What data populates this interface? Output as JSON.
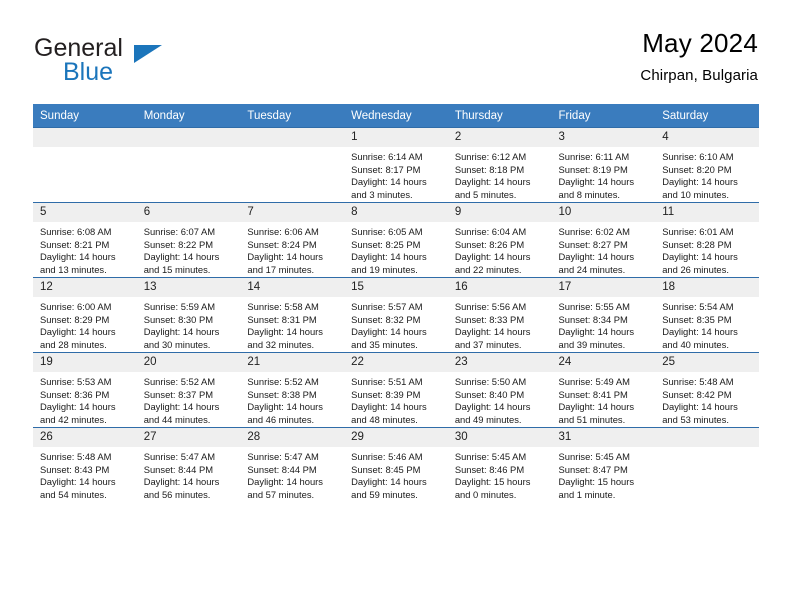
{
  "brand": {
    "name_part1": "General",
    "name_part2": "Blue",
    "triangle_icon": "triangle-icon",
    "accent_color": "#1b75bb"
  },
  "header": {
    "title": "May 2024",
    "subtitle": "Chirpan, Bulgaria"
  },
  "theme": {
    "header_row_bg": "#3a7cbe",
    "row_divider": "#2f6ca8",
    "daynum_bg": "#efefef"
  },
  "calendar": {
    "weekday_headers": [
      "Sunday",
      "Monday",
      "Tuesday",
      "Wednesday",
      "Thursday",
      "Friday",
      "Saturday"
    ],
    "weeks": [
      [
        {
          "day": "",
          "empty": true,
          "sunrise": "",
          "sunset": "",
          "daylight1": "",
          "daylight2": ""
        },
        {
          "day": "",
          "empty": true,
          "sunrise": "",
          "sunset": "",
          "daylight1": "",
          "daylight2": ""
        },
        {
          "day": "",
          "empty": true,
          "sunrise": "",
          "sunset": "",
          "daylight1": "",
          "daylight2": ""
        },
        {
          "day": "1",
          "empty": false,
          "sunrise": "Sunrise: 6:14 AM",
          "sunset": "Sunset: 8:17 PM",
          "daylight1": "Daylight: 14 hours",
          "daylight2": "and 3 minutes."
        },
        {
          "day": "2",
          "empty": false,
          "sunrise": "Sunrise: 6:12 AM",
          "sunset": "Sunset: 8:18 PM",
          "daylight1": "Daylight: 14 hours",
          "daylight2": "and 5 minutes."
        },
        {
          "day": "3",
          "empty": false,
          "sunrise": "Sunrise: 6:11 AM",
          "sunset": "Sunset: 8:19 PM",
          "daylight1": "Daylight: 14 hours",
          "daylight2": "and 8 minutes."
        },
        {
          "day": "4",
          "empty": false,
          "sunrise": "Sunrise: 6:10 AM",
          "sunset": "Sunset: 8:20 PM",
          "daylight1": "Daylight: 14 hours",
          "daylight2": "and 10 minutes."
        }
      ],
      [
        {
          "day": "5",
          "empty": false,
          "sunrise": "Sunrise: 6:08 AM",
          "sunset": "Sunset: 8:21 PM",
          "daylight1": "Daylight: 14 hours",
          "daylight2": "and 13 minutes."
        },
        {
          "day": "6",
          "empty": false,
          "sunrise": "Sunrise: 6:07 AM",
          "sunset": "Sunset: 8:22 PM",
          "daylight1": "Daylight: 14 hours",
          "daylight2": "and 15 minutes."
        },
        {
          "day": "7",
          "empty": false,
          "sunrise": "Sunrise: 6:06 AM",
          "sunset": "Sunset: 8:24 PM",
          "daylight1": "Daylight: 14 hours",
          "daylight2": "and 17 minutes."
        },
        {
          "day": "8",
          "empty": false,
          "sunrise": "Sunrise: 6:05 AM",
          "sunset": "Sunset: 8:25 PM",
          "daylight1": "Daylight: 14 hours",
          "daylight2": "and 19 minutes."
        },
        {
          "day": "9",
          "empty": false,
          "sunrise": "Sunrise: 6:04 AM",
          "sunset": "Sunset: 8:26 PM",
          "daylight1": "Daylight: 14 hours",
          "daylight2": "and 22 minutes."
        },
        {
          "day": "10",
          "empty": false,
          "sunrise": "Sunrise: 6:02 AM",
          "sunset": "Sunset: 8:27 PM",
          "daylight1": "Daylight: 14 hours",
          "daylight2": "and 24 minutes."
        },
        {
          "day": "11",
          "empty": false,
          "sunrise": "Sunrise: 6:01 AM",
          "sunset": "Sunset: 8:28 PM",
          "daylight1": "Daylight: 14 hours",
          "daylight2": "and 26 minutes."
        }
      ],
      [
        {
          "day": "12",
          "empty": false,
          "sunrise": "Sunrise: 6:00 AM",
          "sunset": "Sunset: 8:29 PM",
          "daylight1": "Daylight: 14 hours",
          "daylight2": "and 28 minutes."
        },
        {
          "day": "13",
          "empty": false,
          "sunrise": "Sunrise: 5:59 AM",
          "sunset": "Sunset: 8:30 PM",
          "daylight1": "Daylight: 14 hours",
          "daylight2": "and 30 minutes."
        },
        {
          "day": "14",
          "empty": false,
          "sunrise": "Sunrise: 5:58 AM",
          "sunset": "Sunset: 8:31 PM",
          "daylight1": "Daylight: 14 hours",
          "daylight2": "and 32 minutes."
        },
        {
          "day": "15",
          "empty": false,
          "sunrise": "Sunrise: 5:57 AM",
          "sunset": "Sunset: 8:32 PM",
          "daylight1": "Daylight: 14 hours",
          "daylight2": "and 35 minutes."
        },
        {
          "day": "16",
          "empty": false,
          "sunrise": "Sunrise: 5:56 AM",
          "sunset": "Sunset: 8:33 PM",
          "daylight1": "Daylight: 14 hours",
          "daylight2": "and 37 minutes."
        },
        {
          "day": "17",
          "empty": false,
          "sunrise": "Sunrise: 5:55 AM",
          "sunset": "Sunset: 8:34 PM",
          "daylight1": "Daylight: 14 hours",
          "daylight2": "and 39 minutes."
        },
        {
          "day": "18",
          "empty": false,
          "sunrise": "Sunrise: 5:54 AM",
          "sunset": "Sunset: 8:35 PM",
          "daylight1": "Daylight: 14 hours",
          "daylight2": "and 40 minutes."
        }
      ],
      [
        {
          "day": "19",
          "empty": false,
          "sunrise": "Sunrise: 5:53 AM",
          "sunset": "Sunset: 8:36 PM",
          "daylight1": "Daylight: 14 hours",
          "daylight2": "and 42 minutes."
        },
        {
          "day": "20",
          "empty": false,
          "sunrise": "Sunrise: 5:52 AM",
          "sunset": "Sunset: 8:37 PM",
          "daylight1": "Daylight: 14 hours",
          "daylight2": "and 44 minutes."
        },
        {
          "day": "21",
          "empty": false,
          "sunrise": "Sunrise: 5:52 AM",
          "sunset": "Sunset: 8:38 PM",
          "daylight1": "Daylight: 14 hours",
          "daylight2": "and 46 minutes."
        },
        {
          "day": "22",
          "empty": false,
          "sunrise": "Sunrise: 5:51 AM",
          "sunset": "Sunset: 8:39 PM",
          "daylight1": "Daylight: 14 hours",
          "daylight2": "and 48 minutes."
        },
        {
          "day": "23",
          "empty": false,
          "sunrise": "Sunrise: 5:50 AM",
          "sunset": "Sunset: 8:40 PM",
          "daylight1": "Daylight: 14 hours",
          "daylight2": "and 49 minutes."
        },
        {
          "day": "24",
          "empty": false,
          "sunrise": "Sunrise: 5:49 AM",
          "sunset": "Sunset: 8:41 PM",
          "daylight1": "Daylight: 14 hours",
          "daylight2": "and 51 minutes."
        },
        {
          "day": "25",
          "empty": false,
          "sunrise": "Sunrise: 5:48 AM",
          "sunset": "Sunset: 8:42 PM",
          "daylight1": "Daylight: 14 hours",
          "daylight2": "and 53 minutes."
        }
      ],
      [
        {
          "day": "26",
          "empty": false,
          "sunrise": "Sunrise: 5:48 AM",
          "sunset": "Sunset: 8:43 PM",
          "daylight1": "Daylight: 14 hours",
          "daylight2": "and 54 minutes."
        },
        {
          "day": "27",
          "empty": false,
          "sunrise": "Sunrise: 5:47 AM",
          "sunset": "Sunset: 8:44 PM",
          "daylight1": "Daylight: 14 hours",
          "daylight2": "and 56 minutes."
        },
        {
          "day": "28",
          "empty": false,
          "sunrise": "Sunrise: 5:47 AM",
          "sunset": "Sunset: 8:44 PM",
          "daylight1": "Daylight: 14 hours",
          "daylight2": "and 57 minutes."
        },
        {
          "day": "29",
          "empty": false,
          "sunrise": "Sunrise: 5:46 AM",
          "sunset": "Sunset: 8:45 PM",
          "daylight1": "Daylight: 14 hours",
          "daylight2": "and 59 minutes."
        },
        {
          "day": "30",
          "empty": false,
          "sunrise": "Sunrise: 5:45 AM",
          "sunset": "Sunset: 8:46 PM",
          "daylight1": "Daylight: 15 hours",
          "daylight2": "and 0 minutes."
        },
        {
          "day": "31",
          "empty": false,
          "sunrise": "Sunrise: 5:45 AM",
          "sunset": "Sunset: 8:47 PM",
          "daylight1": "Daylight: 15 hours",
          "daylight2": "and 1 minute."
        },
        {
          "day": "",
          "empty": true,
          "sunrise": "",
          "sunset": "",
          "daylight1": "",
          "daylight2": ""
        }
      ]
    ]
  }
}
